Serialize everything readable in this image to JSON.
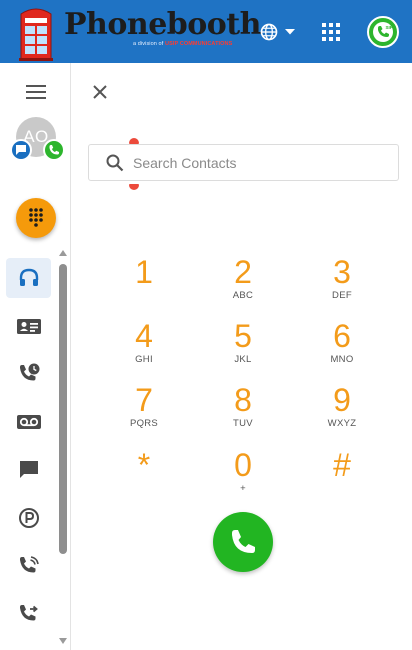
{
  "header": {
    "brand_name": "Phonebooth",
    "brand_sub_prefix": "a division of",
    "brand_sub_accent": "USIP COMMUNICATIONS",
    "language_icon": "globe-icon",
    "apps_icon": "apps-grid-icon",
    "presence_icon": "sip-phone-icon",
    "presence_badge": "SIP"
  },
  "sidebar": {
    "avatar_initials": "AO",
    "nav": [
      {
        "name": "contact-center",
        "icon": "headset-icon",
        "active": true
      },
      {
        "name": "contacts",
        "icon": "contact-card-icon"
      },
      {
        "name": "recent-calls",
        "icon": "call-history-icon"
      },
      {
        "name": "voicemail",
        "icon": "voicemail-icon"
      },
      {
        "name": "messages",
        "icon": "chat-icon"
      },
      {
        "name": "park",
        "icon": "parking-icon"
      },
      {
        "name": "ring-group",
        "icon": "phone-ringing-icon"
      },
      {
        "name": "call-forward",
        "icon": "phone-forward-icon"
      }
    ]
  },
  "search": {
    "placeholder": "Search Contacts",
    "value": ""
  },
  "dialpad": {
    "keys": [
      {
        "digit": "1",
        "letters": ""
      },
      {
        "digit": "2",
        "letters": "ABC"
      },
      {
        "digit": "3",
        "letters": "DEF"
      },
      {
        "digit": "4",
        "letters": "GHI"
      },
      {
        "digit": "5",
        "letters": "JKL"
      },
      {
        "digit": "6",
        "letters": "MNO"
      },
      {
        "digit": "7",
        "letters": "PQRS"
      },
      {
        "digit": "8",
        "letters": "TUV"
      },
      {
        "digit": "9",
        "letters": "WXYZ"
      },
      {
        "digit": "*",
        "letters": ""
      },
      {
        "digit": "0",
        "letters": "+"
      },
      {
        "digit": "#",
        "letters": ""
      }
    ]
  },
  "colors": {
    "header_bg": "#1f73c4",
    "accent_orange": "#f59a0b",
    "call_green": "#22b522"
  }
}
